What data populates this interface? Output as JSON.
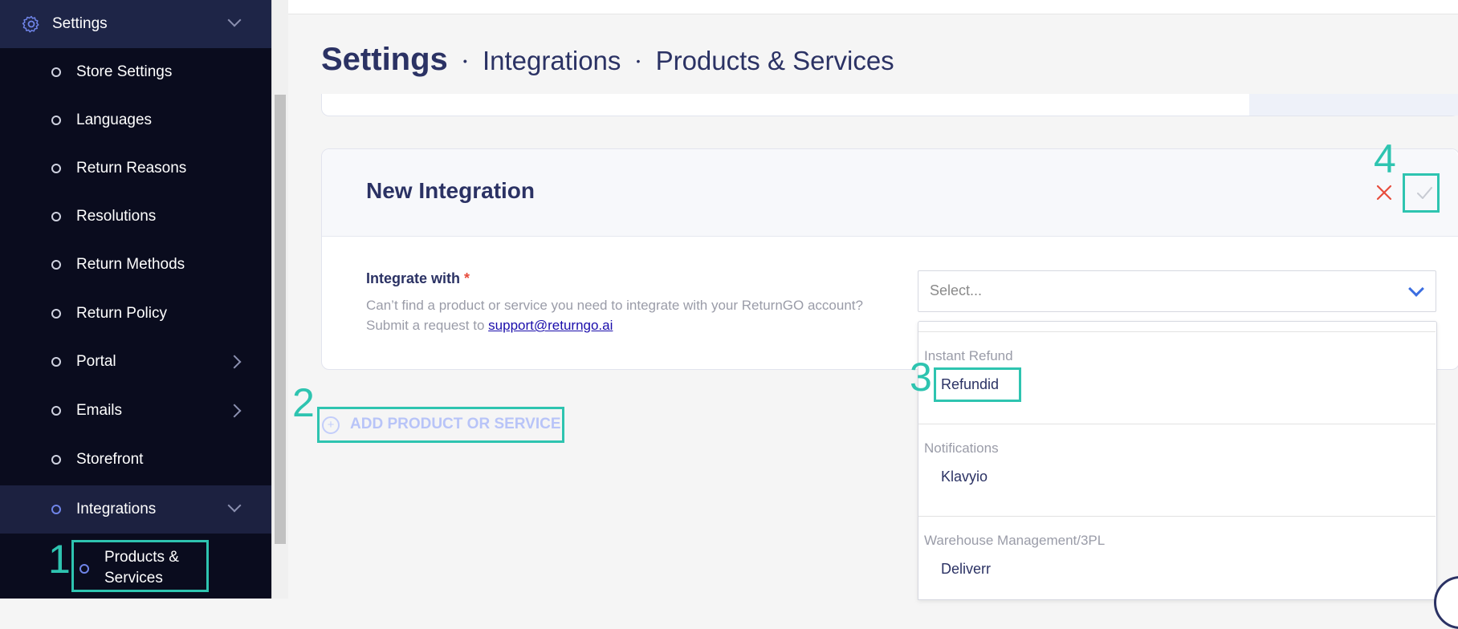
{
  "sidebar": {
    "settings_label": "Settings",
    "items": [
      {
        "label": "Store Settings"
      },
      {
        "label": "Languages"
      },
      {
        "label": "Return Reasons"
      },
      {
        "label": "Resolutions"
      },
      {
        "label": "Return Methods"
      },
      {
        "label": "Return Policy"
      },
      {
        "label": "Portal"
      },
      {
        "label": "Emails"
      },
      {
        "label": "Storefront"
      },
      {
        "label": "Integrations"
      }
    ],
    "sub_item_line1": "Products &",
    "sub_item_line2": "Services"
  },
  "breadcrumb": {
    "root": "Settings",
    "level1": "Integrations",
    "level2": "Products & Services",
    "separator": "•"
  },
  "card": {
    "title": "New Integration",
    "field_label": "Integrate with",
    "required_mark": "*",
    "help_text": "Can’t find a product or service you need to integrate with your ReturnGO account? Submit a request to",
    "help_link": "support@returngo.ai"
  },
  "select": {
    "placeholder": "Select...",
    "groups": [
      {
        "name": "Instant Refund",
        "option": "Refundid"
      },
      {
        "name": "Notifications",
        "option": "Klavyio"
      },
      {
        "name": "Warehouse Management/3PL",
        "option": "Deliverr"
      }
    ]
  },
  "add_button_label": "ADD PRODUCT OR SERVICE",
  "annotations": {
    "n1": "1",
    "n2": "2",
    "n3": "3",
    "n4": "4"
  },
  "colors": {
    "sidebar_bg": "#0a0c1e",
    "sidebar_active_bg": "#1e2547",
    "title_color": "#2b3264",
    "highlight": "#2ec4b0",
    "close_red": "#e74c3c",
    "accent_blue": "#3b6de0"
  },
  "icons": {
    "settings": "gear-icon",
    "close": "close-icon",
    "confirm": "check-icon",
    "add": "plus-circle-icon",
    "expand": "chevron-down-icon"
  }
}
